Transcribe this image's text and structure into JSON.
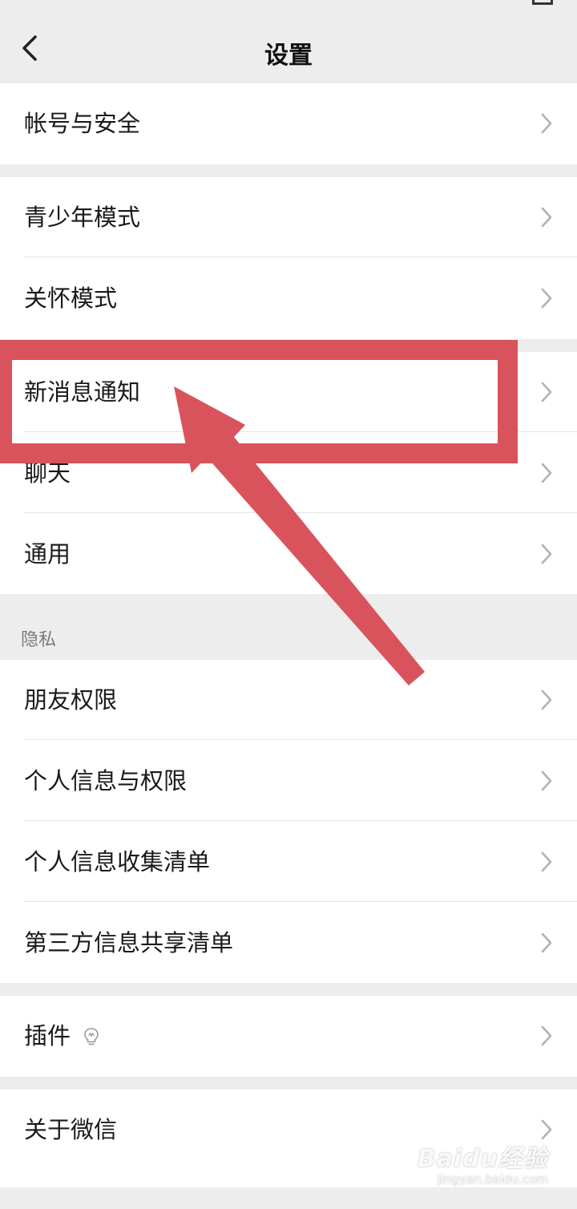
{
  "header": {
    "title": "设置"
  },
  "groups": [
    {
      "items": [
        {
          "label": "帐号与安全"
        }
      ]
    },
    {
      "items": [
        {
          "label": "青少年模式"
        },
        {
          "label": "关怀模式"
        }
      ]
    },
    {
      "items": [
        {
          "label": "新消息通知"
        },
        {
          "label": "聊天"
        },
        {
          "label": "通用"
        }
      ]
    },
    {
      "section_title": "隐私",
      "items": [
        {
          "label": "朋友权限"
        },
        {
          "label": "个人信息与权限"
        },
        {
          "label": "个人信息收集清单"
        },
        {
          "label": "第三方信息共享清单"
        }
      ]
    },
    {
      "items": [
        {
          "label": "插件",
          "icon": "bulb-icon"
        }
      ]
    },
    {
      "items": [
        {
          "label": "关于微信"
        }
      ]
    }
  ],
  "annotation": {
    "highlighted_item": "新消息通知",
    "color": "#d9535c"
  },
  "watermark": {
    "logo": "Baidu经验",
    "url": "jingyan.baidu.com"
  },
  "colors": {
    "background": "#ededed",
    "row_background": "#ffffff",
    "divider": "#e4e4e4",
    "chevron": "#b2b2b2"
  }
}
